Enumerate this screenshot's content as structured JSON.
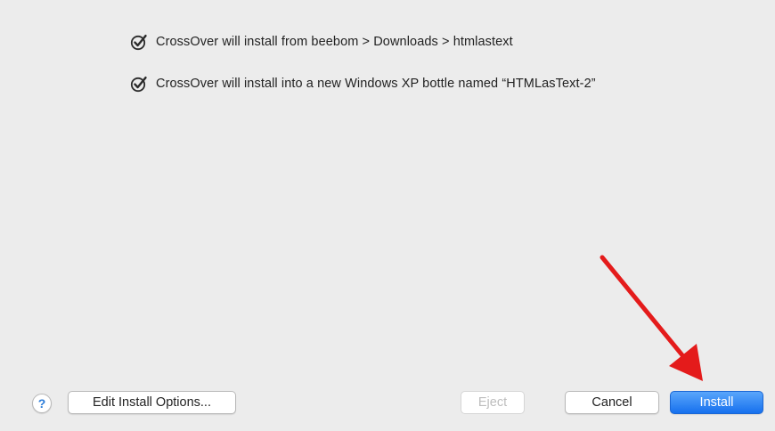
{
  "checklist": [
    {
      "icon": "check-circle-icon",
      "text": "CrossOver will install from beebom > Downloads > htmlastext"
    },
    {
      "icon": "check-circle-icon",
      "text": "CrossOver will install into a new Windows XP bottle named “HTMLasText-2”"
    }
  ],
  "footer": {
    "help_label": "?",
    "edit_label": "Edit Install Options...",
    "eject_label": "Eject",
    "cancel_label": "Cancel",
    "install_label": "Install"
  },
  "colors": {
    "background": "#ececec",
    "accent": "#1670ee",
    "annotation_arrow": "#e41b1b"
  },
  "annotation": {
    "icon": "red-arrow-icon"
  }
}
